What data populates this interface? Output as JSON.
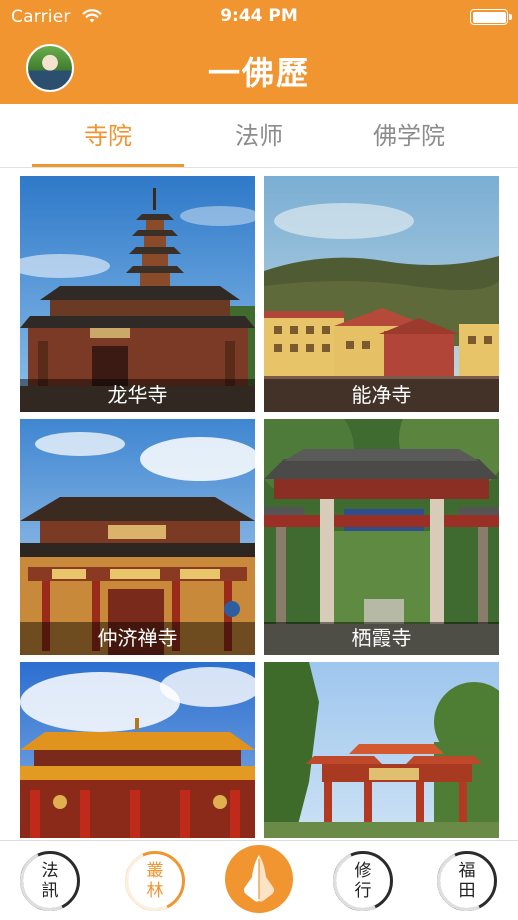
{
  "status_bar": {
    "carrier": "Carrier",
    "time": "9:44 PM",
    "wifi_icon": "wifi-icon",
    "battery_level": 1.0
  },
  "header": {
    "title": "一佛歷",
    "avatar_icon": "avatar",
    "background_color": "#f0952f"
  },
  "tabs": [
    {
      "label": "寺院",
      "active": true
    },
    {
      "label": "法师",
      "active": false
    },
    {
      "label": "佛学院",
      "active": false
    }
  ],
  "temples": [
    {
      "name": "龙华寺"
    },
    {
      "name": "能净寺"
    },
    {
      "name": "仲济禅寺"
    },
    {
      "name": "栖霞寺"
    },
    {
      "name": ""
    },
    {
      "name": ""
    }
  ],
  "bottom_nav": [
    {
      "label_top": "法",
      "label_bottom": "訊",
      "active": false
    },
    {
      "label_top": "叢",
      "label_bottom": "林",
      "active": true
    },
    {
      "label_top": "",
      "label_bottom": "",
      "icon": "praying-hands-icon",
      "active": false
    },
    {
      "label_top": "修",
      "label_bottom": "行",
      "active": false
    },
    {
      "label_top": "福",
      "label_bottom": "田",
      "active": false
    }
  ],
  "colors": {
    "accent": "#f0952f",
    "inactive_text": "#8c8c8c"
  }
}
